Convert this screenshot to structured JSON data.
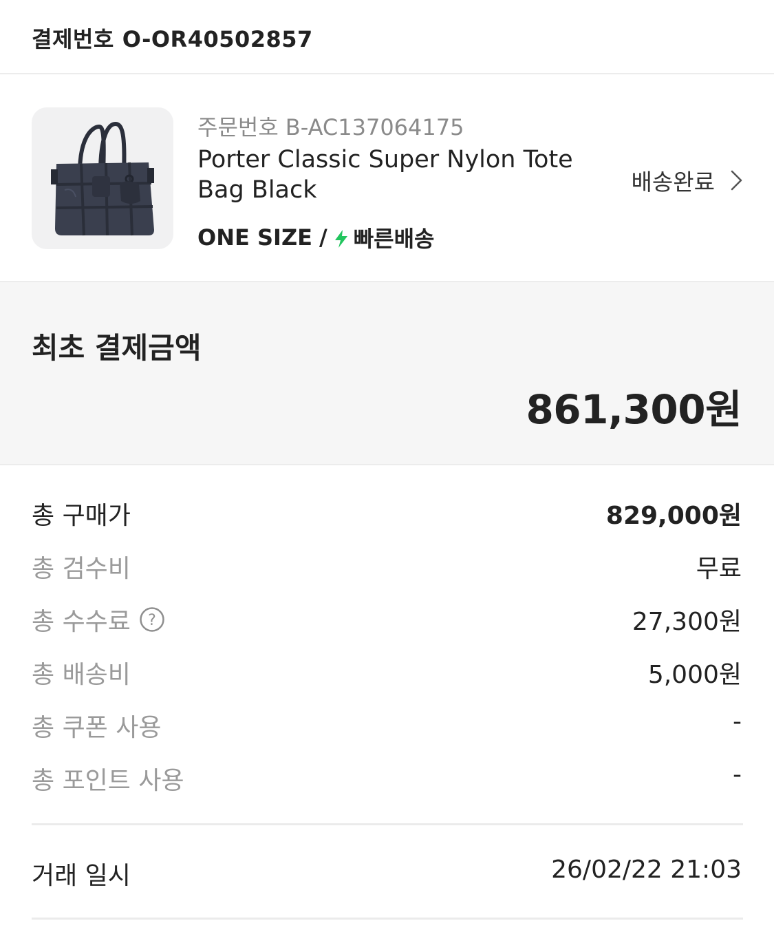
{
  "header": {
    "label": "결제번호",
    "number": "O-OR40502857"
  },
  "product": {
    "order_label": "주문번호",
    "order_number": "B-AC137064175",
    "name": "Porter Classic Super Nylon Tote Bag Black",
    "size": "ONE SIZE",
    "separator": "/",
    "shipping_type": "빠른배송",
    "status": "배송완료",
    "image_icon": "tote-bag-image",
    "bolt_color": "#22c55e"
  },
  "initial_payment": {
    "label": "최초 결제금액",
    "amount": "861,300원"
  },
  "breakdown": {
    "total_purchase": {
      "label": "총 구매가",
      "value": "829,000원"
    },
    "inspection_fee": {
      "label": "총 검수비",
      "value": "무료"
    },
    "commission": {
      "label": "총 수수료",
      "value": "27,300원",
      "help": "?"
    },
    "shipping_fee": {
      "label": "총 배송비",
      "value": "5,000원"
    },
    "coupon": {
      "label": "총 쿠폰 사용",
      "value": "-"
    },
    "points": {
      "label": "총 포인트 사용",
      "value": "-"
    }
  },
  "transaction": {
    "label": "거래 일시",
    "datetime": "26/02/22 21:03"
  }
}
